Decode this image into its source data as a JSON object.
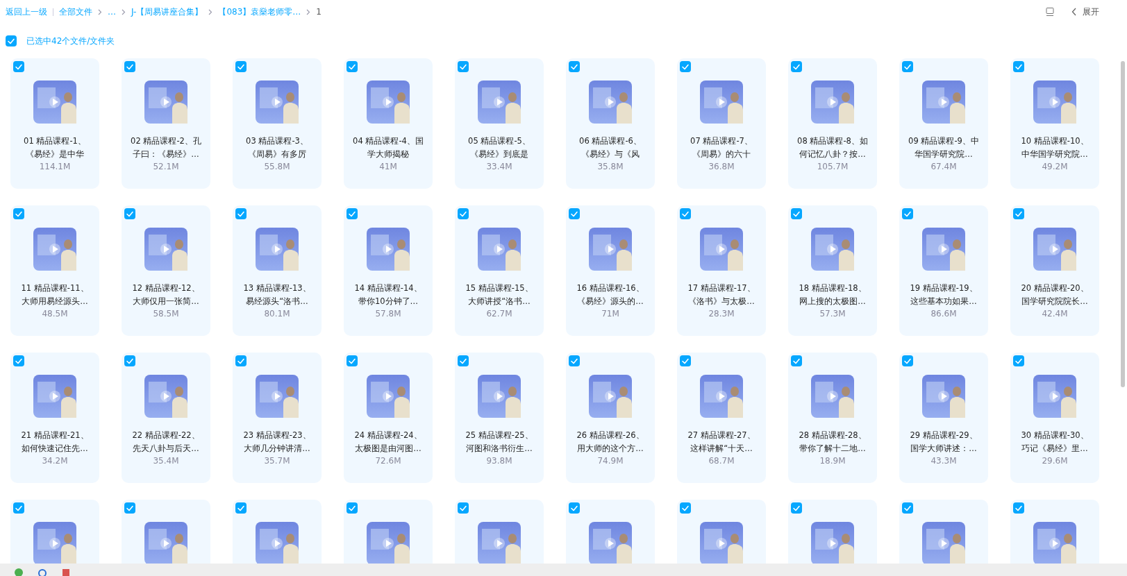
{
  "breadcrumb": {
    "back": "返回上一级",
    "items": [
      {
        "label": "全部文件"
      },
      {
        "label": "…"
      },
      {
        "label": "J-【周易讲座合集】"
      },
      {
        "label": "【083】袁燊老师零…"
      },
      {
        "label": "1"
      }
    ]
  },
  "toolbar": {
    "expand": "展开"
  },
  "selection": {
    "checked": true,
    "label": "已选中42个文件/文件夹"
  },
  "files": [
    {
      "name": "01 精品课程-1、《易经》是中华",
      "size": "114.1M",
      "checked": true
    },
    {
      "name": "02 精品课程-2、孔子曰：《易经》…",
      "size": "52.1M",
      "checked": true
    },
    {
      "name": "03 精品课程-3、《周易》有多厉",
      "size": "55.8M",
      "checked": true
    },
    {
      "name": "04 精品课程-4、国学大师揭秘",
      "size": "41M",
      "checked": true
    },
    {
      "name": "05 精品课程-5、《易经》到底是",
      "size": "33.4M",
      "checked": true
    },
    {
      "name": "06 精品课程-6、《易经》与《风",
      "size": "35.8M",
      "checked": true
    },
    {
      "name": "07 精品课程-7、《周易》的六十",
      "size": "36.8M",
      "checked": true
    },
    {
      "name": "08 精品课程-8、如何记忆八卦？按…",
      "size": "105.7M",
      "checked": true
    },
    {
      "name": "09 精品课程-9、中华国学研究院…",
      "size": "67.4M",
      "checked": true
    },
    {
      "name": "10 精品课程-10、中华国学研究院…",
      "size": "49.2M",
      "checked": true
    },
    {
      "name": "11 精品课程-11、大师用易经源头…",
      "size": "48.5M",
      "checked": true
    },
    {
      "name": "12 精品课程-12、大师仅用一张简…",
      "size": "58.5M",
      "checked": true
    },
    {
      "name": "13 精品课程-13、易经源头“洛书…",
      "size": "80.1M",
      "checked": true
    },
    {
      "name": "14 精品课程-14、带你10分钟了…",
      "size": "57.8M",
      "checked": true
    },
    {
      "name": "15 精品课程-15、大师讲授“洛书…",
      "size": "62.7M",
      "checked": true
    },
    {
      "name": "16 精品课程-16、《易经》源头的…",
      "size": "71M",
      "checked": true
    },
    {
      "name": "17 精品课程-17、《洛书》与太极…",
      "size": "28.3M",
      "checked": true
    },
    {
      "name": "18 精品课程-18、网上搜的太极图…",
      "size": "57.3M",
      "checked": true
    },
    {
      "name": "19 精品课程-19、这些基本功如果…",
      "size": "86.6M",
      "checked": true
    },
    {
      "name": "20 精品课程-20、国学研究院院长…",
      "size": "42.4M",
      "checked": true
    },
    {
      "name": "21 精品课程-21、如何快速记住先…",
      "size": "34.2M",
      "checked": true
    },
    {
      "name": "22 精品课程-22、先天八卦与后天…",
      "size": "35.4M",
      "checked": true
    },
    {
      "name": "23 精品课程-23、大师几分钟讲清…",
      "size": "35.7M",
      "checked": true
    },
    {
      "name": "24 精品课程-24、太极图是由河图…",
      "size": "72.6M",
      "checked": true
    },
    {
      "name": "25 精品课程-25、河图和洛书衍生…",
      "size": "93.8M",
      "checked": true
    },
    {
      "name": "26 精品课程-26、用大师的这个方…",
      "size": "74.9M",
      "checked": true
    },
    {
      "name": "27 精品课程-27、这样讲解“十天…",
      "size": "68.7M",
      "checked": true
    },
    {
      "name": "28 精品课程-28、带你了解十二地…",
      "size": "18.9M",
      "checked": true
    },
    {
      "name": "29 精品课程-29、国学大师讲述：…",
      "size": "43.3M",
      "checked": true
    },
    {
      "name": "30 精品课程-30、巧记《易经》里…",
      "size": "29.6M",
      "checked": true
    },
    {
      "checked": true
    },
    {
      "checked": true
    },
    {
      "checked": true
    },
    {
      "checked": true
    },
    {
      "checked": true
    },
    {
      "checked": true
    },
    {
      "checked": true
    },
    {
      "checked": true
    },
    {
      "checked": true
    },
    {
      "checked": true
    }
  ]
}
